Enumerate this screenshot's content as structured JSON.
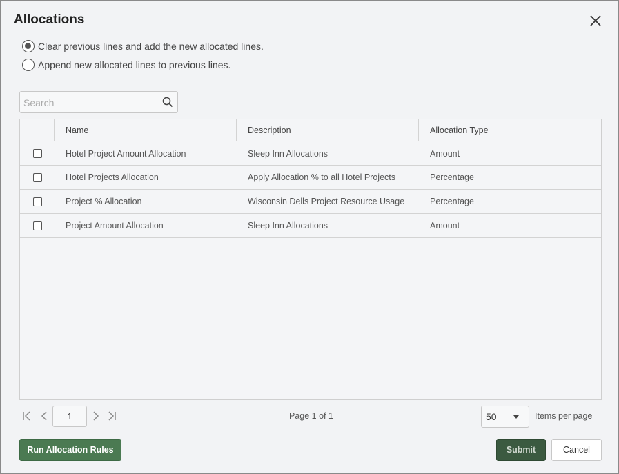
{
  "dialog": {
    "title": "Allocations",
    "close_icon": "close-icon"
  },
  "options": [
    {
      "label": "Clear previous lines and add the new allocated lines.",
      "selected": true
    },
    {
      "label": "Append new allocated lines to previous lines.",
      "selected": false
    }
  ],
  "search": {
    "placeholder": "Search",
    "value": "",
    "icon": "search-icon"
  },
  "grid": {
    "columns": [
      "Name",
      "Description",
      "Allocation Type"
    ],
    "rows": [
      {
        "checked": false,
        "name": "Hotel Project Amount Allocation",
        "description": "Sleep Inn Allocations",
        "type": "Amount"
      },
      {
        "checked": false,
        "name": "Hotel Projects Allocation",
        "description": "Apply Allocation % to all Hotel Projects",
        "type": "Percentage"
      },
      {
        "checked": false,
        "name": "Project % Allocation",
        "description": "Wisconsin Dells Project Resource Usage",
        "type": "Percentage"
      },
      {
        "checked": false,
        "name": "Project Amount Allocation",
        "description": "Sleep Inn Allocations",
        "type": "Amount"
      }
    ]
  },
  "pager": {
    "current_page": "1",
    "page_label": "Page 1 of 1",
    "items_per_page": "50",
    "items_per_page_label": "Items per page",
    "icons": [
      "first-page-icon",
      "prev-page-icon",
      "next-page-icon",
      "last-page-icon"
    ]
  },
  "footer": {
    "run_label": "Run Allocation Rules",
    "submit_label": "Submit",
    "cancel_label": "Cancel"
  },
  "colors": {
    "primary_button": "#4b7a52",
    "submit_button": "#3b5a40",
    "background": "#f2f3f5"
  }
}
